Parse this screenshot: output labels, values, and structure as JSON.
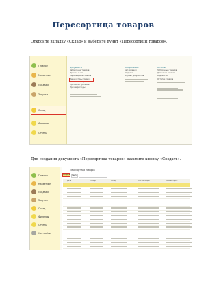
{
  "title": "Пересортица товаров",
  "step1": "Откройте вкладку «Склад» и выберите пункт «Пересортицы товаров».",
  "step2": "Для создания документа «Пересортица товаров» нажмите кнопку «Создать».",
  "screenshot1": {
    "sidebar_items": [
      "Главное",
      "Маркетинг",
      "Продажи",
      "Закупки",
      "Склад",
      "Финансы",
      "Отчеты",
      "Настройки"
    ],
    "active_item": "Склад",
    "columns": [
      {
        "header": "Документы",
        "items": [
          "Заборочные товаров",
          "Приемный акт",
          "Перемещения товаров",
          "Пересортицы товаров",
          "Списание товаров",
          "Прочее поступление",
          "Прочие расходы"
        ]
      },
      {
        "header": "Оформление",
        "items": [
          "Акт приемки",
          "Загрузки",
          "Журнал документов"
        ]
      },
      {
        "header": "Отчеты",
        "items": [
          "Заборочные товаров",
          "Движение товаров",
          "Ведомость",
          "Остатки товаров"
        ]
      }
    ]
  },
  "screenshot2": {
    "window_title": "Пересортица товаров",
    "buttons": [
      "Создать",
      "Найти"
    ],
    "table_header": [
      "Дата",
      "Номер",
      "Склад",
      "Организация",
      "Комментарий"
    ],
    "row_count": 17
  }
}
